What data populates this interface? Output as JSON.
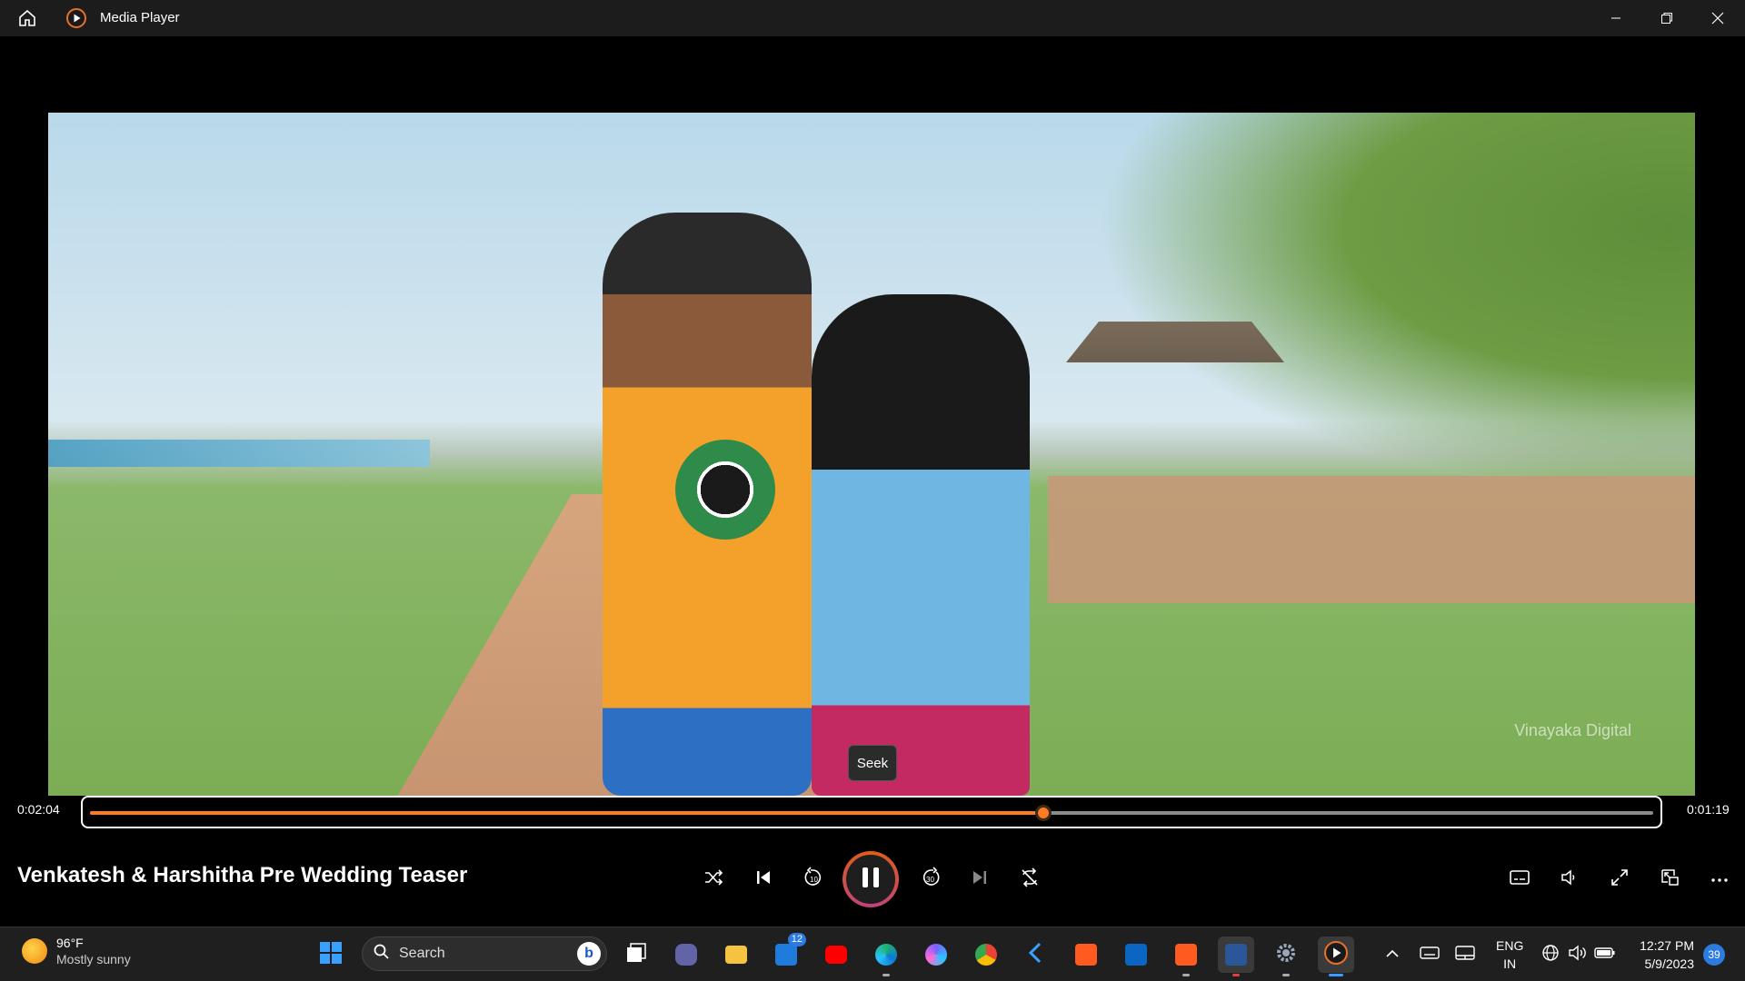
{
  "window": {
    "title": "Media Player"
  },
  "video": {
    "title": "Venkatesh & Harshitha Pre Wedding Teaser",
    "elapsed": "0:02:04",
    "remaining": "0:01:19",
    "progress": 0.61,
    "seek_tooltip": "Seek",
    "watermark": "Vinayaka Digital"
  },
  "controls": {
    "left": [
      "shuffle-icon",
      "previous-icon",
      "rewind-10-icon"
    ],
    "play_state": "playing",
    "right": [
      "forward-30-icon",
      "next-icon",
      "repeat-icon"
    ],
    "tools": [
      "captions-icon",
      "volume-icon",
      "fullscreen-icon",
      "miniplayer-icon",
      "more-icon"
    ]
  },
  "taskbar": {
    "weather_temp": "96°F",
    "weather_desc": "Mostly sunny",
    "search_placeholder": "Search",
    "mail_badge": "12",
    "lang_top": "ENG",
    "lang_bottom": "IN",
    "time": "12:27 PM",
    "date": "5/9/2023",
    "notifications": "39"
  },
  "colors": {
    "accent": "#ff7a22",
    "taskbar": "#1f1f1f",
    "titlebar": "#1c1c1c"
  }
}
